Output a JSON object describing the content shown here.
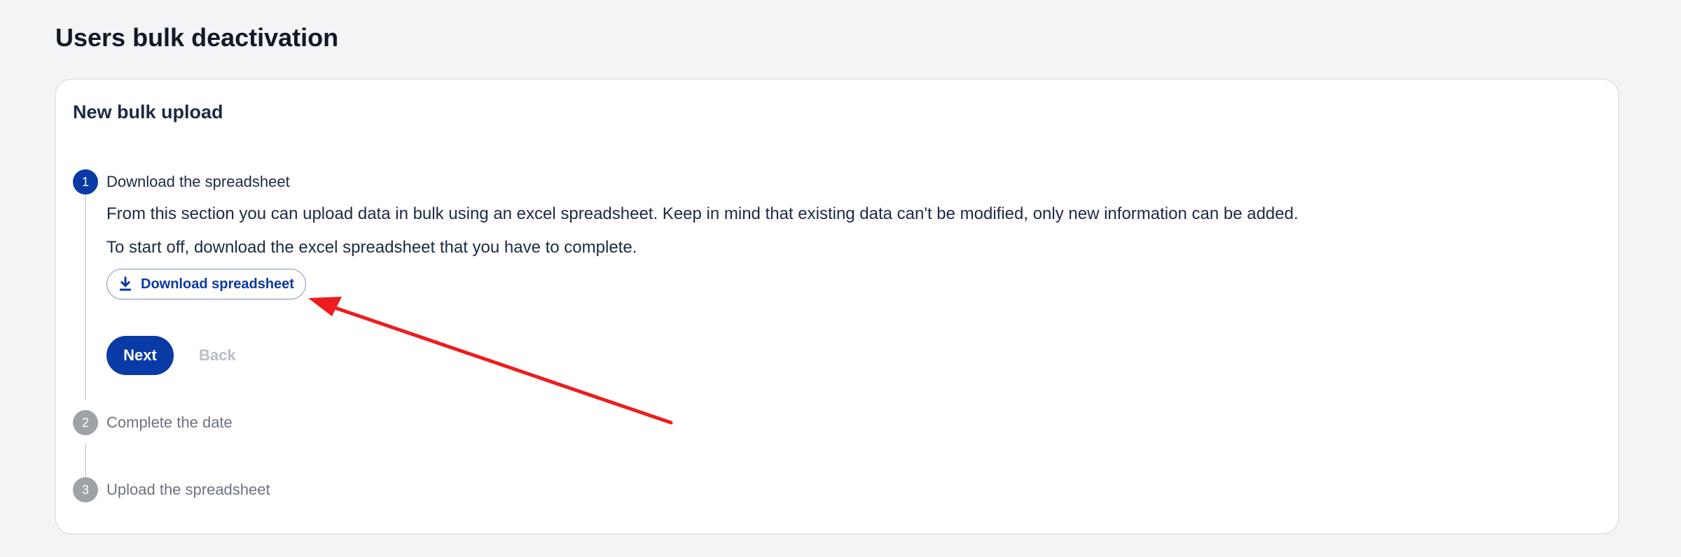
{
  "page": {
    "title": "Users bulk deactivation"
  },
  "card": {
    "title": "New bulk upload"
  },
  "steps": [
    {
      "number": "1",
      "title": "Download the spreadsheet",
      "state": "active",
      "description": "From this section you can upload data in bulk using an excel spreadsheet. Keep in mind that existing data can't be modified, only new information can be added.",
      "instruction": "To start off, download the excel spreadsheet that you have to complete.",
      "download_button": {
        "label": "Download spreadsheet",
        "icon": "download-icon"
      },
      "next_button": {
        "label": "Next"
      },
      "back_button": {
        "label": "Back",
        "enabled": false
      }
    },
    {
      "number": "2",
      "title": "Complete the date",
      "state": "inactive"
    },
    {
      "number": "3",
      "title": "Upload the spreadsheet",
      "state": "inactive"
    }
  ],
  "colors": {
    "primary": "#0a3aa5",
    "annotation": "#ee1c1c",
    "inactive_step": "#9ea3a9"
  }
}
